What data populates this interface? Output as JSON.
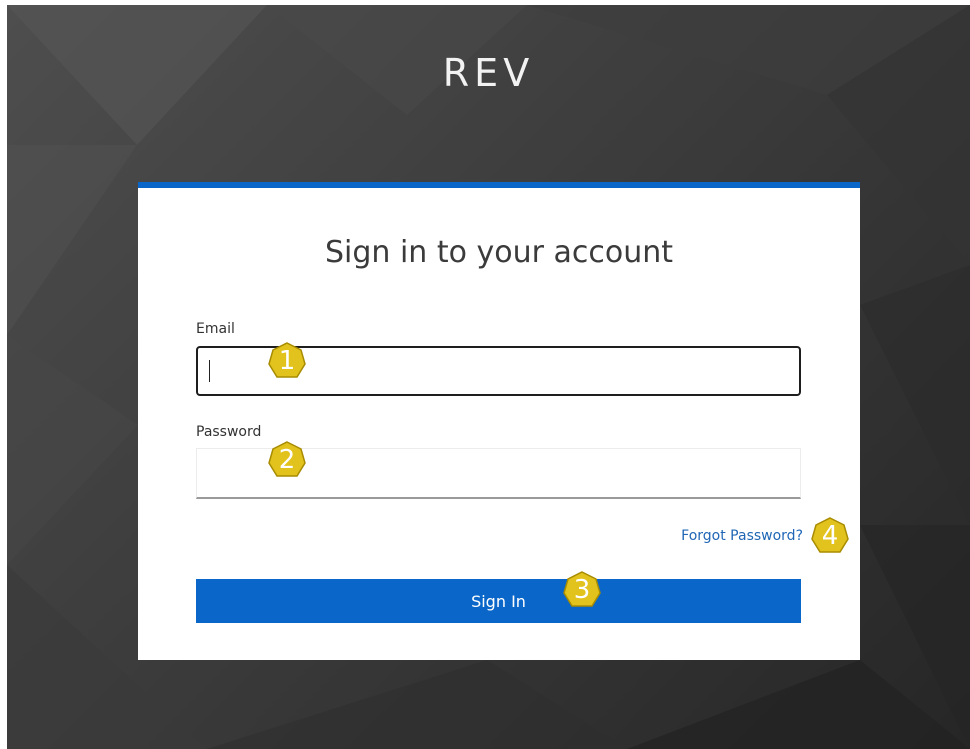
{
  "app": {
    "brand": "REV"
  },
  "card": {
    "title": "Sign in to your account",
    "accent_color": "#0a66c8"
  },
  "form": {
    "email": {
      "label": "Email",
      "value": "",
      "placeholder": ""
    },
    "password": {
      "label": "Password",
      "value": "",
      "placeholder": ""
    },
    "forgot_password_label": "Forgot Password?",
    "sign_in_label": "Sign In"
  },
  "annotations": [
    {
      "number": "1",
      "target": "email-field"
    },
    {
      "number": "2",
      "target": "password-field"
    },
    {
      "number": "3",
      "target": "signin-button"
    },
    {
      "number": "4",
      "target": "forgot-password-link"
    }
  ],
  "colors": {
    "background": "#3a3a3a",
    "primary": "#0a66c8",
    "link": "#1f66b5",
    "badge_fill": "#e2c21c"
  }
}
